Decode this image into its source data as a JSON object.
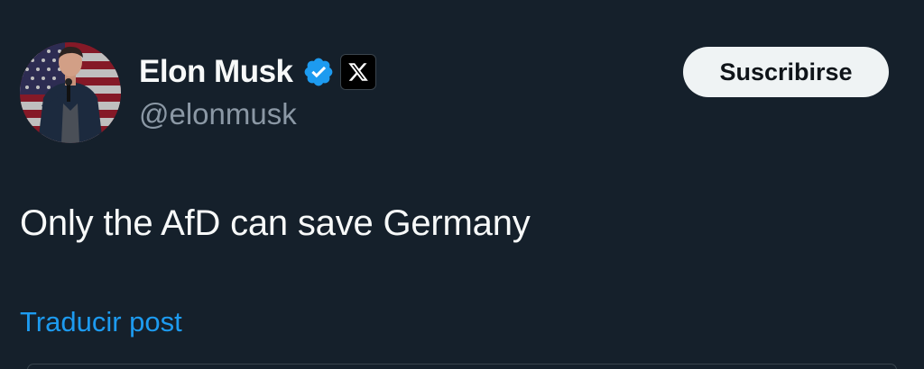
{
  "post": {
    "author": {
      "display_name": "Elon Musk",
      "handle": "@elonmusk",
      "verified": true,
      "affiliation_badge": "x-logo-icon"
    },
    "subscribe_label": "Suscribirse",
    "text": "Only the AfD can save Germany",
    "translate_label": "Traducir post"
  },
  "colors": {
    "background": "#15202b",
    "primary_text": "#f7f9f9",
    "secondary_text": "#8b98a5",
    "link": "#1d9bf0",
    "verified_badge": "#1d9bf0",
    "button_bg": "#eff3f4",
    "button_text": "#0f1419"
  }
}
